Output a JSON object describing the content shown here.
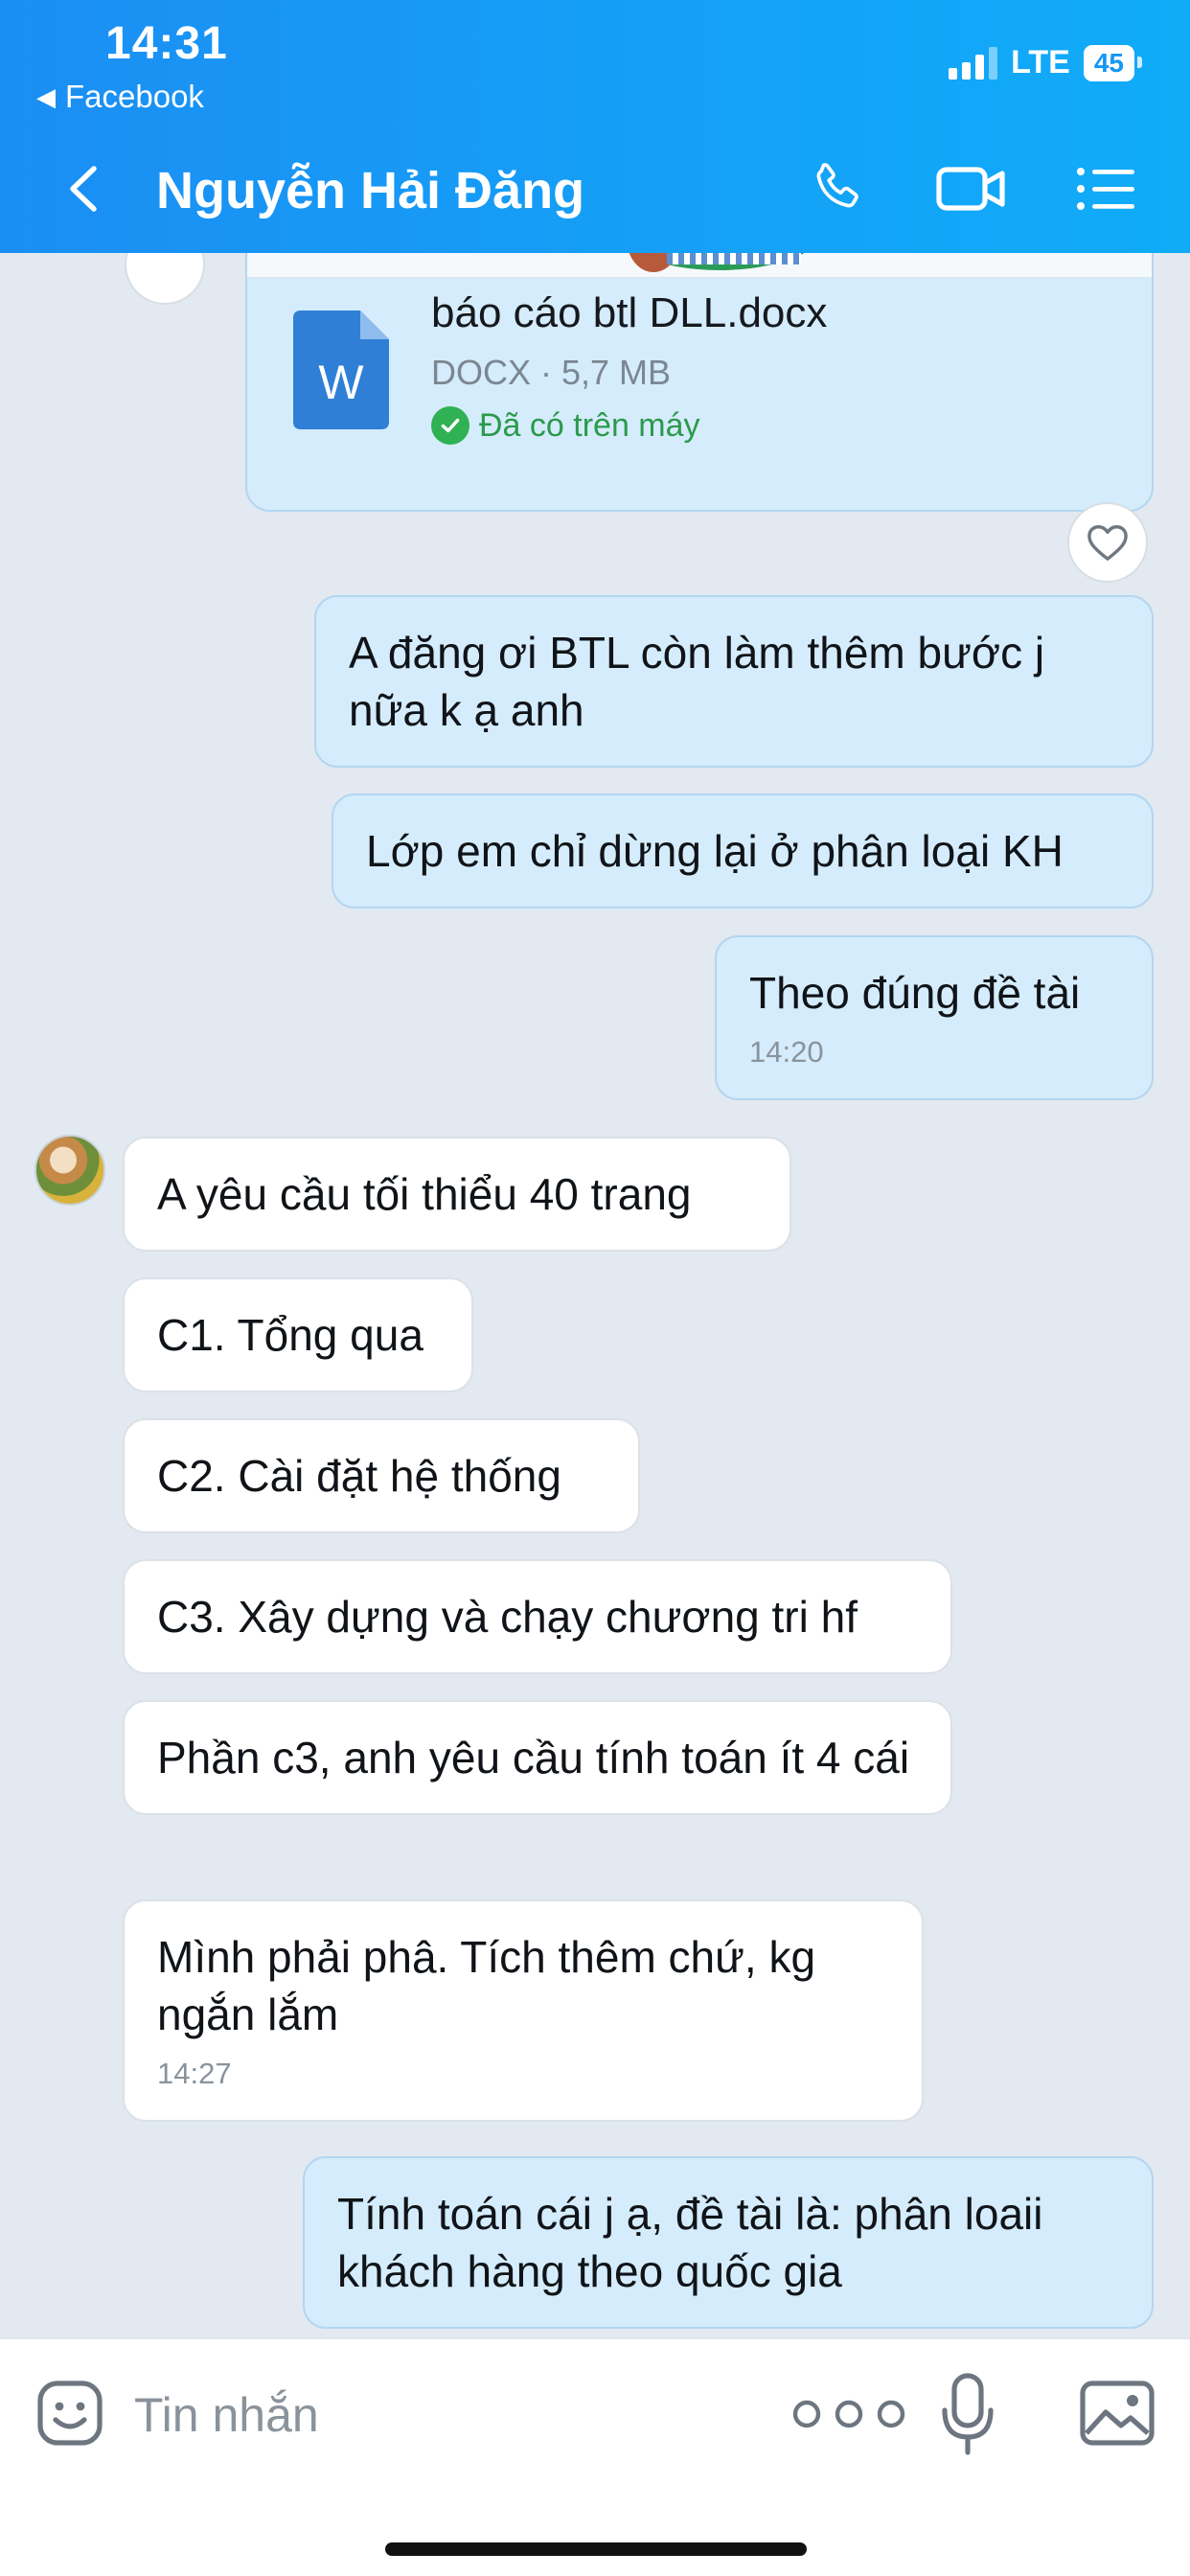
{
  "status_bar": {
    "time": "14:31",
    "back_app": "Facebook",
    "network": "LTE",
    "battery": "45"
  },
  "header": {
    "title": "Nguyễn Hải Đăng"
  },
  "file_message": {
    "file_name": "báo cáo btl DLL.docx",
    "file_meta": "DOCX · 5,7 MB",
    "file_status": "Đã có trên máy",
    "doc_letter": "W"
  },
  "messages": {
    "out_1": "A đăng ơi BTL còn làm thêm bước j nữa k ạ anh",
    "out_2": "Lớp em chỉ dừng lại ở phân loại KH",
    "out_3": "Theo đúng đề tài",
    "out_3_time": "14:20",
    "in_1": "A yêu cầu tối thiểu 40 trang",
    "in_2": "C1. Tổng qua",
    "in_3": "C2. Cài đặt hệ thống",
    "in_4": "C3. Xây dựng và chạy chương tri hf",
    "in_5": "Phần c3, anh yêu cầu tính toán ít 4 cái",
    "in_6": "Mình phải phâ. Tích thêm chứ, kg ngắn lắm",
    "in_6_time": "14:27",
    "out_4": "Tính toán cái j ạ, đề tài là: phân loaii khách hàng theo quốc gia"
  },
  "input_bar": {
    "placeholder": "Tin nhắn"
  },
  "colors": {
    "header": "#1597f5",
    "outgoing_bubble": "#d5ecfc",
    "incoming_bubble": "#ffffff",
    "chat_background": "#e2e9f1"
  }
}
